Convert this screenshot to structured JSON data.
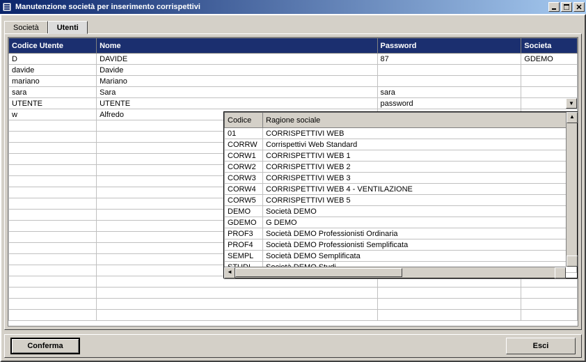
{
  "window": {
    "title": "Manutenzione società per inserimento corrispettivi"
  },
  "tabs": {
    "societa": "Società",
    "utenti": "Utenti"
  },
  "grid": {
    "headers": {
      "codice": "Codice Utente",
      "nome": "Nome",
      "password": "Password",
      "societa": "Societa"
    },
    "rows": [
      {
        "codice": "D",
        "nome": "DAVIDE",
        "password": "87",
        "societa": "GDEMO"
      },
      {
        "codice": "davide",
        "nome": "Davide",
        "password": "",
        "societa": ""
      },
      {
        "codice": "mariano",
        "nome": "Mariano",
        "password": "",
        "societa": ""
      },
      {
        "codice": "sara",
        "nome": "Sara",
        "password": "sara",
        "societa": ""
      },
      {
        "codice": "UTENTE",
        "nome": "UTENTE",
        "password": "password",
        "societa": ""
      },
      {
        "codice": "w",
        "nome": "Alfredo",
        "password": "",
        "societa": ""
      }
    ]
  },
  "popup": {
    "headers": {
      "codice": "Codice",
      "ragione": "Ragione sociale"
    },
    "rows": [
      {
        "codice": "01",
        "ragione": "CORRISPETTIVI WEB"
      },
      {
        "codice": "CORRW",
        "ragione": "Corrispettivi Web Standard"
      },
      {
        "codice": "CORW1",
        "ragione": "CORRISPETTIVI WEB 1"
      },
      {
        "codice": "CORW2",
        "ragione": "CORRISPETTIVI WEB 2"
      },
      {
        "codice": "CORW3",
        "ragione": "CORRISPETTIVI WEB 3"
      },
      {
        "codice": "CORW4",
        "ragione": "CORRISPETTIVI WEB 4 - VENTILAZIONE"
      },
      {
        "codice": "CORW5",
        "ragione": "CORRISPETTIVI WEB 5"
      },
      {
        "codice": "DEMO",
        "ragione": "Società DEMO"
      },
      {
        "codice": "GDEMO",
        "ragione": "G DEMO"
      },
      {
        "codice": "PROF3",
        "ragione": "Società DEMO Professionisti Ordinaria"
      },
      {
        "codice": "PROF4",
        "ragione": "Società DEMO Professionisti Semplificata"
      },
      {
        "codice": "SEMPL",
        "ragione": "Società DEMO Semplificata"
      },
      {
        "codice": "STUDI",
        "ragione": "Società DEMO Studi"
      }
    ]
  },
  "buttons": {
    "conferma": "Conferma",
    "esci": "Esci"
  }
}
